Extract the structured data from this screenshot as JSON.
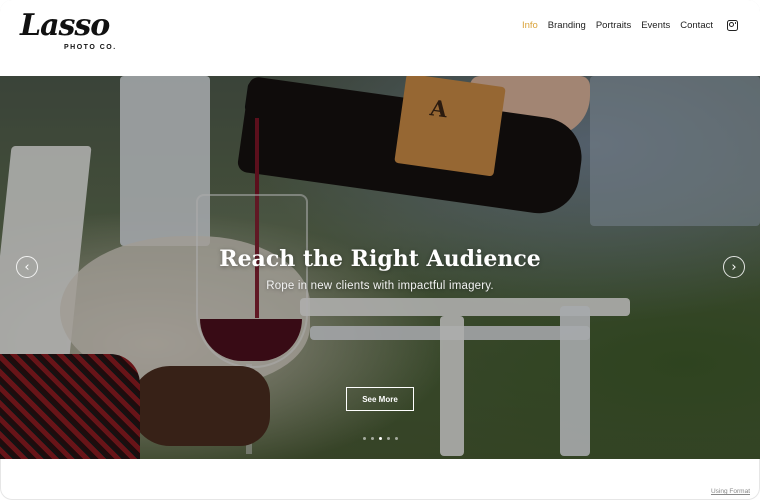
{
  "brand": {
    "name": "Lasso",
    "sub": "PHOTO CO."
  },
  "nav": {
    "items": [
      {
        "label": "Info",
        "active": true
      },
      {
        "label": "Branding",
        "active": false
      },
      {
        "label": "Portraits",
        "active": false
      },
      {
        "label": "Events",
        "active": false
      },
      {
        "label": "Contact",
        "active": false
      }
    ],
    "social_icon": "instagram-icon",
    "active_color": "#d9a33a"
  },
  "hero": {
    "title": "Reach the Right Audience",
    "subtitle": "Rope in new clients with impactful imagery.",
    "cta_label": "See More",
    "prev_symbol": "‹",
    "next_symbol": "›",
    "bottle_label": "A",
    "slides_total": 5,
    "slide_active": 3
  },
  "footer": {
    "link": "Using Format"
  }
}
